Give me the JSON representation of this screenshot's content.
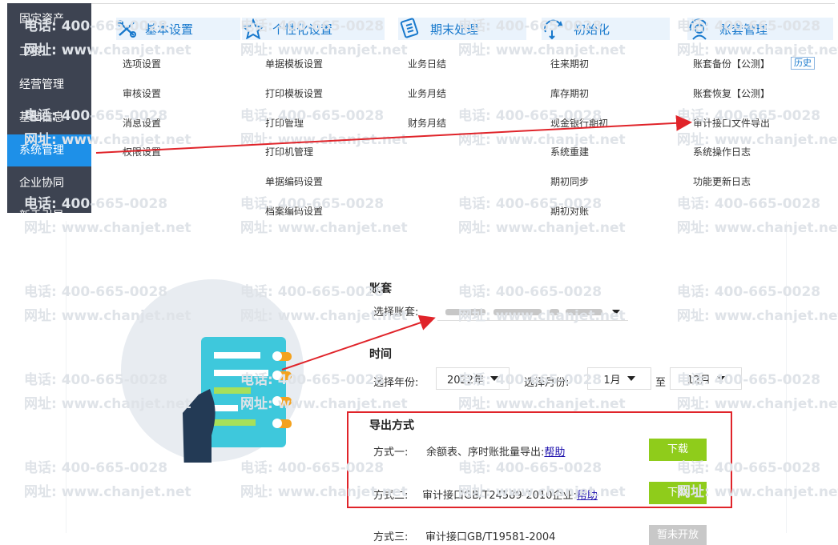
{
  "sidebar": {
    "items": [
      "固定资产",
      "工资",
      "经营管理",
      "基础信息",
      "系统管理",
      "企业协同",
      "新手引导"
    ],
    "active": "系统管理"
  },
  "menu": {
    "heads": [
      {
        "label": "基本设置",
        "icon": "wrench-icon"
      },
      {
        "label": "个性化设置",
        "icon": "star-icon"
      },
      {
        "label": "期末处理",
        "icon": "clipboard-icon"
      },
      {
        "label": "初始化",
        "icon": "refresh-icon"
      },
      {
        "label": "账套管理",
        "icon": "user-icon"
      }
    ],
    "col1": [
      "选项设置",
      "审核设置",
      "消息设置",
      "权限设置"
    ],
    "col2": [
      "单据模板设置",
      "打印模板设置",
      "打印管理",
      "打印机管理",
      "单据编码设置",
      "档案编码设置"
    ],
    "col3": [
      "业务日结",
      "业务月结",
      "财务月结"
    ],
    "col4": [
      "往来期初",
      "库存期初",
      "现金银行期初",
      "系统重建",
      "期初同步",
      "期初对账"
    ],
    "col5": [
      "账套备份【公测】",
      "账套恢复【公测】",
      "审计接口文件导出",
      "系统操作日志",
      "功能更新日志"
    ],
    "history": "历史"
  },
  "form": {
    "account": {
      "title": "账套",
      "label": "选择账套:"
    },
    "time": {
      "title": "时间",
      "year_label": "选择年份:",
      "year": "2022年",
      "month_label": "选择月份:",
      "month_from": "1月",
      "to": "至",
      "month_to": "12月"
    },
    "export": {
      "title": "导出方式",
      "method1": {
        "label": "方式一:",
        "desc": "余额表、序时账批量导出:",
        "help": "帮助",
        "button": "下载"
      },
      "method2": {
        "label": "方式二:",
        "desc": "审计接口GB/T24589-2010企业:",
        "help": "帮助",
        "button": "下载"
      },
      "method3": {
        "label": "方式三:",
        "desc": "审计接口GB/T19581-2004",
        "button": "暂未开放"
      }
    }
  },
  "watermark": {
    "phone": "电话: 400-665-0028",
    "site": "网址: www.chanjet.net"
  },
  "colors": {
    "sidebar_bg": "#3d4351",
    "sidebar_active": "#1e90e8",
    "accent": "#1778cc",
    "download_button": "#8fcc1b",
    "annotation_red": "#e0242a",
    "illustration_circle": "#e8ecf1",
    "clipboard": "#3ec8dc"
  }
}
